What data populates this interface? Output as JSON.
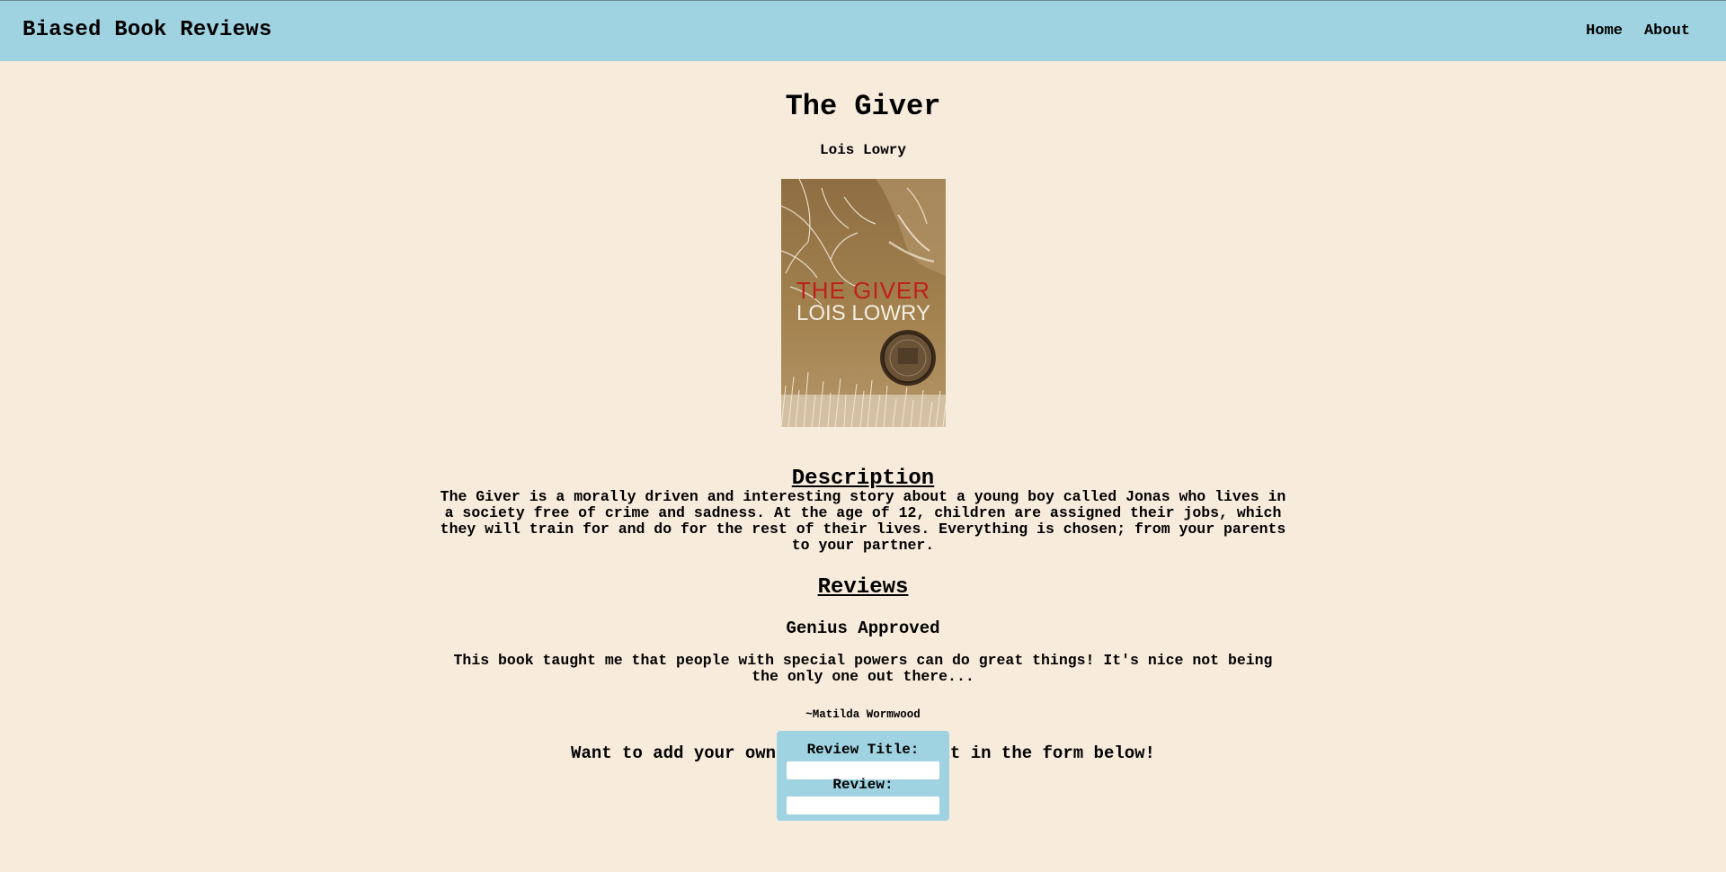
{
  "header": {
    "brand": "Biased Book Reviews",
    "nav": {
      "home": "Home",
      "about": "About"
    }
  },
  "book": {
    "title": "The Giver",
    "author": "Lois Lowry",
    "cover": {
      "title_text": "THE GIVER",
      "author_text": "LOIS LOWRY",
      "colors": {
        "background": "#9c7a4a",
        "title": "#c0201a",
        "author": "#f3ede1"
      }
    }
  },
  "description": {
    "heading": "Description",
    "text": "The Giver is a morally driven and interesting story about a young boy called Jonas who lives in a society free of crime and sadness. At the age of 12, children are assigned their jobs, which they will train for and do for the rest of their lives. Everything is chosen; from your parents to your partner."
  },
  "reviews": {
    "heading": "Reviews",
    "items": [
      {
        "title": "Genius Approved",
        "body": "This book taught me that people with special powers can do great things! It's nice not being the only one out there...",
        "signature": "~Matilda Wormwood"
      }
    ]
  },
  "form": {
    "cta": "Want to add your own review? Create it in the form below!",
    "title_label": "Review Title:",
    "title_value": "",
    "review_label": "Review:",
    "review_value": ""
  },
  "colors": {
    "page_background": "#f7ebdc",
    "header_background": "#9fd3e1",
    "form_background": "#9fd3e1"
  }
}
